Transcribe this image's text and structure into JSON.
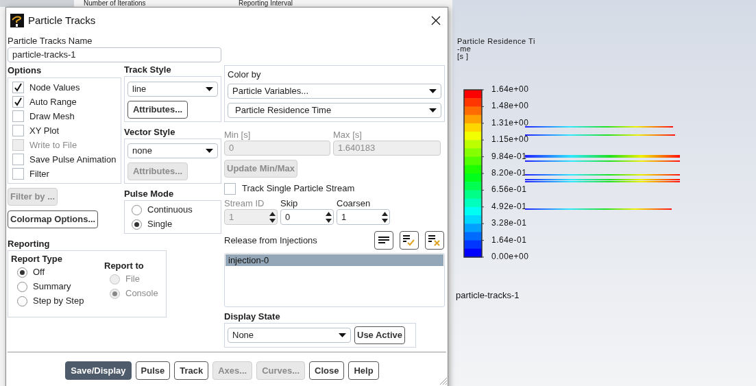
{
  "background": {
    "column_1": "Number of Iterations",
    "column_2": "Reporting Interval"
  },
  "dialog": {
    "title": "Particle Tracks"
  },
  "name_field": {
    "label": "Particle Tracks Name",
    "value": "particle-tracks-1"
  },
  "options": {
    "title": "Options",
    "items": [
      {
        "label": "Node Values",
        "checked": true,
        "disabled": false
      },
      {
        "label": "Auto Range",
        "checked": true,
        "disabled": false
      },
      {
        "label": "Draw Mesh",
        "checked": false,
        "disabled": false
      },
      {
        "label": "XY Plot",
        "checked": false,
        "disabled": false
      },
      {
        "label": "Write to File",
        "checked": false,
        "disabled": true
      },
      {
        "label": "Save Pulse Animation",
        "checked": false,
        "disabled": false
      },
      {
        "label": "Filter",
        "checked": false,
        "disabled": false
      }
    ]
  },
  "filter_button": {
    "label": "Filter by ...",
    "disabled": true
  },
  "colormap_button": {
    "label": "Colormap Options...",
    "disabled": false
  },
  "track_style": {
    "title": "Track Style",
    "value": "line",
    "button": {
      "label": "Attributes...",
      "disabled": false
    }
  },
  "vector_style": {
    "title": "Vector Style",
    "value": "none",
    "button": {
      "label": "Attributes...",
      "disabled": true
    }
  },
  "pulse_mode": {
    "title": "Pulse Mode",
    "options": [
      {
        "label": "Continuous",
        "selected": false
      },
      {
        "label": "Single",
        "selected": true
      }
    ]
  },
  "reporting": {
    "title": "Reporting",
    "report_type": {
      "title": "Report Type",
      "disabled": false,
      "options": [
        {
          "label": "Off",
          "selected": true
        },
        {
          "label": "Summary",
          "selected": false
        },
        {
          "label": "Step by Step",
          "selected": false
        }
      ]
    },
    "report_to": {
      "title": "Report to",
      "disabled": true,
      "options": [
        {
          "label": "File",
          "selected": false
        },
        {
          "label": "Console",
          "selected": true
        }
      ]
    }
  },
  "color_by": {
    "label": "Color by",
    "values": [
      "Particle Variables...",
      "Particle Residence Time"
    ]
  },
  "min": {
    "label": "Min [s]",
    "value": "0",
    "disabled": true
  },
  "max": {
    "label": "Max [s]",
    "value": "1.640183",
    "disabled": true
  },
  "update_button": {
    "label": "Update Min/Max",
    "disabled": true
  },
  "track_single": {
    "label": "Track Single Particle Stream",
    "checked": false
  },
  "spinners": [
    {
      "label": "Stream ID",
      "value": "1",
      "disabled": true
    },
    {
      "label": "Skip",
      "value": "0",
      "disabled": false
    },
    {
      "label": "Coarsen",
      "value": "1",
      "disabled": false
    }
  ],
  "injections": {
    "label": "Release from Injections",
    "items": [
      {
        "label": "injection-0",
        "selected": true
      }
    ]
  },
  "display_state": {
    "title": "Display State",
    "value": "None",
    "button": "Use Active"
  },
  "buttons": [
    {
      "label": "Save/Display",
      "kind": "primary",
      "disabled": false
    },
    {
      "label": "Pulse",
      "kind": "normal",
      "disabled": false
    },
    {
      "label": "Track",
      "kind": "normal",
      "disabled": false
    },
    {
      "label": "Axes...",
      "kind": "normal",
      "disabled": true
    },
    {
      "label": "Curves...",
      "kind": "normal",
      "disabled": true
    },
    {
      "label": "Close",
      "kind": "normal",
      "disabled": false
    },
    {
      "label": "Help",
      "kind": "normal",
      "disabled": false
    }
  ],
  "graphics": {
    "legend_title": [
      "Particle Residence Ti",
      "-me",
      "[s ]"
    ],
    "legend_labels": [
      "1.64e+00",
      "1.48e+00",
      "1.31e+00",
      "1.15e+00",
      "9.84e-01",
      "8.20e-01",
      "6.56e-01",
      "4.92e-01",
      "3.28e-01",
      "1.64e-01",
      "0.00e+00"
    ],
    "caption": "particle-tracks-1"
  }
}
